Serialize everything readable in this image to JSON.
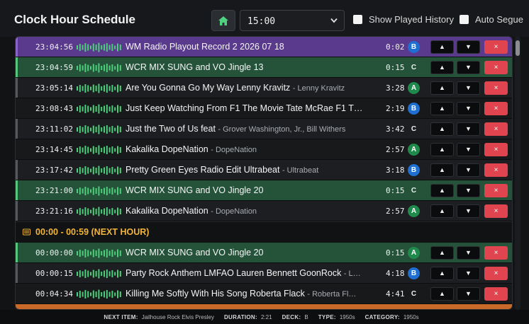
{
  "header": {
    "title": "Clock Hour Schedule",
    "hour_select_value": "15:00",
    "show_played_history_label": "Show Played History",
    "auto_segue_label": "Auto Segue"
  },
  "colors": {
    "accent_green": "#55c77d",
    "played_purple": "#5a3a8c",
    "jingle_green": "#25533a",
    "delete_red": "#e0454f",
    "next_hour_gold": "#f2b53a",
    "cat_A": "#1f8a4c",
    "cat_B": "#1e6fd1"
  },
  "rows_group1": [
    {
      "time": "23:04:56",
      "title": "WM Radio Playout Record 2 2026 07 18",
      "artist": "",
      "duration": "0:02",
      "category": "B",
      "kind": "played"
    },
    {
      "time": "23:04:59",
      "title": "WCR MIX SUNG and VO Jingle 13",
      "artist": "",
      "duration": "0:15",
      "category": "C",
      "kind": "jingle"
    },
    {
      "time": "23:05:14",
      "title": "Are You Gonna Go My Way Lenny Kravitz",
      "artist": "- Lenny Kravitz",
      "duration": "3:28",
      "category": "A",
      "kind": "normal"
    },
    {
      "time": "23:08:43",
      "title": "Just Keep Watching From F1 The Movie Tate McRae F1 T…",
      "artist": "",
      "duration": "2:19",
      "category": "B",
      "kind": "alt"
    },
    {
      "time": "23:11:02",
      "title": "Just the Two of Us feat",
      "artist": "- Grover Washington, Jr., Bill Withers",
      "duration": "3:42",
      "category": "C",
      "kind": "normal"
    },
    {
      "time": "23:14:45",
      "title": "Kakalika DopeNation",
      "artist": "- DopeNation",
      "duration": "2:57",
      "category": "A",
      "kind": "alt"
    },
    {
      "time": "23:17:42",
      "title": "Pretty Green Eyes Radio Edit Ultrabeat",
      "artist": "- Ultrabeat",
      "duration": "3:18",
      "category": "B",
      "kind": "normal"
    },
    {
      "time": "23:21:00",
      "title": "WCR MIX SUNG and VO Jingle 20",
      "artist": "",
      "duration": "0:15",
      "category": "C",
      "kind": "jingle"
    },
    {
      "time": "23:21:16",
      "title": "Kakalika DopeNation",
      "artist": "- DopeNation",
      "duration": "2:57",
      "category": "A",
      "kind": "normal"
    }
  ],
  "next_hour": {
    "label": "00:00 - 00:59 (NEXT HOUR)"
  },
  "rows_group2": [
    {
      "time": "00:00:00",
      "title": "WCR MIX SUNG and VO Jingle 20",
      "artist": "",
      "duration": "0:15",
      "category": "A",
      "kind": "jingle"
    },
    {
      "time": "00:00:15",
      "title": "Party Rock Anthem LMFAO Lauren Bennett GoonRock",
      "artist": "- L…",
      "duration": "4:18",
      "category": "B",
      "kind": "normal"
    },
    {
      "time": "00:04:34",
      "title": "Killing Me Softly With His Song Roberta Flack",
      "artist": "- Roberta Fl…",
      "duration": "4:41",
      "category": "C",
      "kind": "alt"
    }
  ],
  "row_buttons": {
    "up": "▲",
    "down": "▼",
    "delete": "×"
  },
  "footer": {
    "next_item_label": "NEXT ITEM:",
    "next_item": "Jailhouse Rock Elvis Presley",
    "duration_label": "DURATION:",
    "duration": "2:21",
    "deck_label": "DECK:",
    "deck": "B",
    "type_label": "TYPE:",
    "type": "1950s",
    "category_label": "CATEGORY:",
    "category": "1950s"
  }
}
